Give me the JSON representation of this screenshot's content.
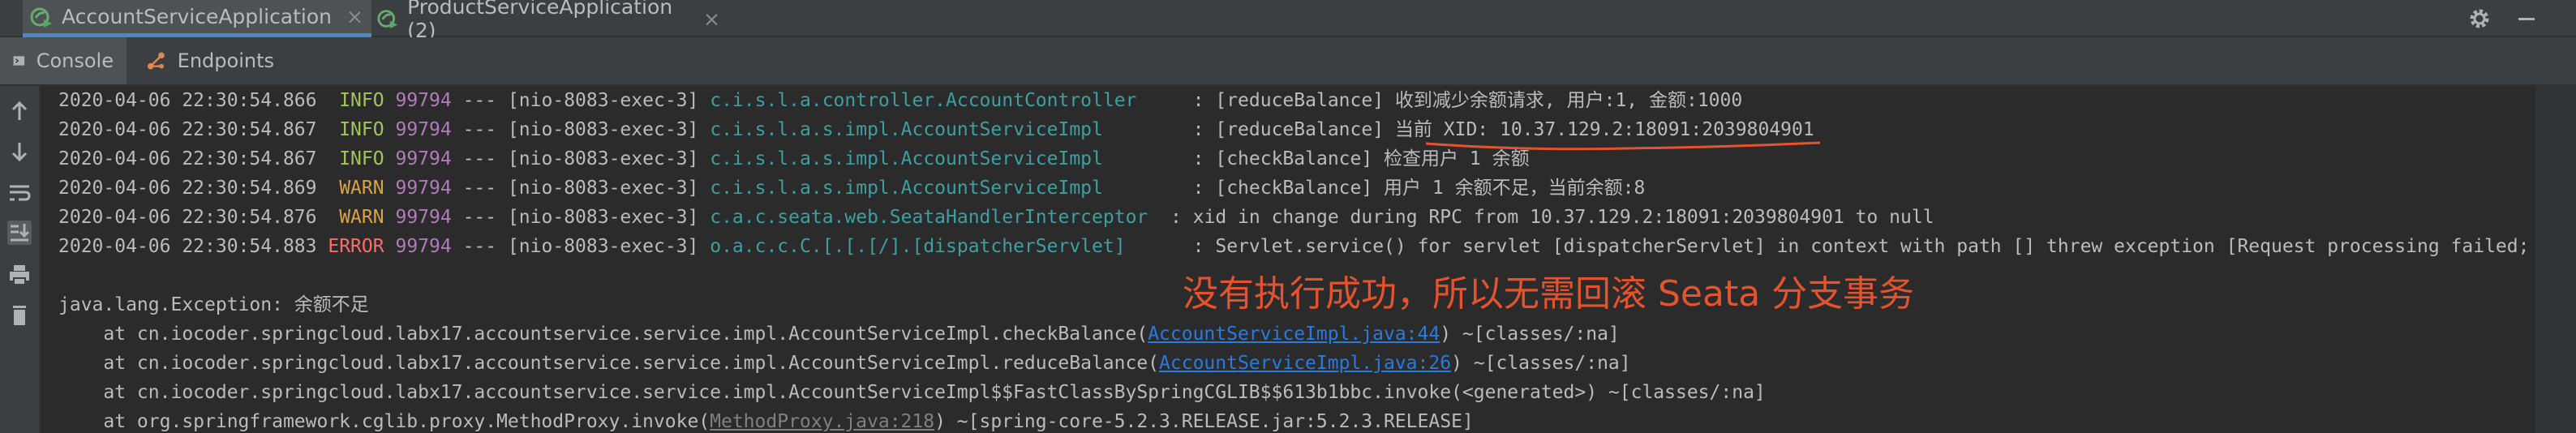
{
  "run_tabs": [
    {
      "label": "AccountServiceApplication",
      "close": "×"
    },
    {
      "label": "ProductServiceApplication (2)",
      "close": "×"
    }
  ],
  "toolbar_icons": {
    "settings": "gear-icon",
    "minimize": "minimize-icon"
  },
  "tool_tabs": [
    {
      "label": "Console"
    },
    {
      "label": "Endpoints"
    }
  ],
  "gutter_icons": [
    "arrow-up-icon",
    "arrow-down-icon",
    "soft-wrap-icon",
    "scroll-to-end-icon",
    "print-icon",
    "trash-icon"
  ],
  "log_lines": [
    {
      "ts": "2020-04-06 22:30:54.866",
      "level": " INFO",
      "pid": "99794",
      "sep": " --- [nio-8083-exec-3] ",
      "logger": "c.i.s.l.a.controller.AccountController  ",
      "msg": "   : [reduceBalance] 收到减少余额请求, 用户:1, 金额:1000"
    },
    {
      "ts": "2020-04-06 22:30:54.867",
      "level": " INFO",
      "pid": "99794",
      "sep": " --- [nio-8083-exec-3] ",
      "logger": "c.i.s.l.a.s.impl.AccountServiceImpl     ",
      "msg": "   : [reduceBalance] 当前 XID: 10.37.129.2:18091:2039804901"
    },
    {
      "ts": "2020-04-06 22:30:54.867",
      "level": " INFO",
      "pid": "99794",
      "sep": " --- [nio-8083-exec-3] ",
      "logger": "c.i.s.l.a.s.impl.AccountServiceImpl     ",
      "msg": "   : [checkBalance] 检查用户 1 余额"
    },
    {
      "ts": "2020-04-06 22:30:54.869",
      "level": " WARN",
      "pid": "99794",
      "sep": " --- [nio-8083-exec-3] ",
      "logger": "c.i.s.l.a.s.impl.AccountServiceImpl     ",
      "msg": "   : [checkBalance] 用户 1 余额不足，当前余额:8"
    },
    {
      "ts": "2020-04-06 22:30:54.876",
      "level": " WARN",
      "pid": "99794",
      "sep": " --- [nio-8083-exec-3] ",
      "logger": "c.a.c.seata.web.SeataHandlerInterceptor ",
      "msg": " : xid in change during RPC from 10.37.129.2:18091:2039804901 to null"
    },
    {
      "ts": "2020-04-06 22:30:54.883",
      "level": "ERROR",
      "pid": "99794",
      "sep": " --- [nio-8083-exec-3] ",
      "logger": "o.a.c.c.C.[.[.[/].[dispatcherServlet]   ",
      "msg": "   : Servlet.service() for servlet [dispatcherServlet] in context with path [] threw exception [Request processing failed;"
    }
  ],
  "exception": {
    "header": "java.lang.Exception: 余额不足",
    "frames": [
      {
        "prefix": "    at cn.iocoder.springcloud.labx17.accountservice.service.impl.AccountServiceImpl.checkBalance(",
        "link": "AccountServiceImpl.java:44",
        "suffix": ") ~[classes/:na]"
      },
      {
        "prefix": "    at cn.iocoder.springcloud.labx17.accountservice.service.impl.AccountServiceImpl.reduceBalance(",
        "link": "AccountServiceImpl.java:26",
        "suffix": ") ~[classes/:na]"
      },
      {
        "prefix": "    at cn.iocoder.springcloud.labx17.accountservice.service.impl.AccountServiceImpl$$FastClassBySpringCGLIB$$613b1bbc.invoke(<generated>) ~[classes/:na]",
        "link": "",
        "suffix": ""
      },
      {
        "prefix": "    at org.springframework.cglib.proxy.MethodProxy.invoke(",
        "link": "MethodProxy.java:218",
        "suffix": ") ~[spring-core-5.2.3.RELEASE.jar:5.2.3.RELEASE]"
      }
    ]
  },
  "annotation": "没有执行成功，所以无需回滚 Seata 分支事务",
  "colors": {
    "annotation": "#e5532e",
    "info": "#a5c25c",
    "warn": "#d9a343",
    "error": "#ff6b68",
    "logger": "#3d9fa0",
    "link": "#287bde"
  }
}
